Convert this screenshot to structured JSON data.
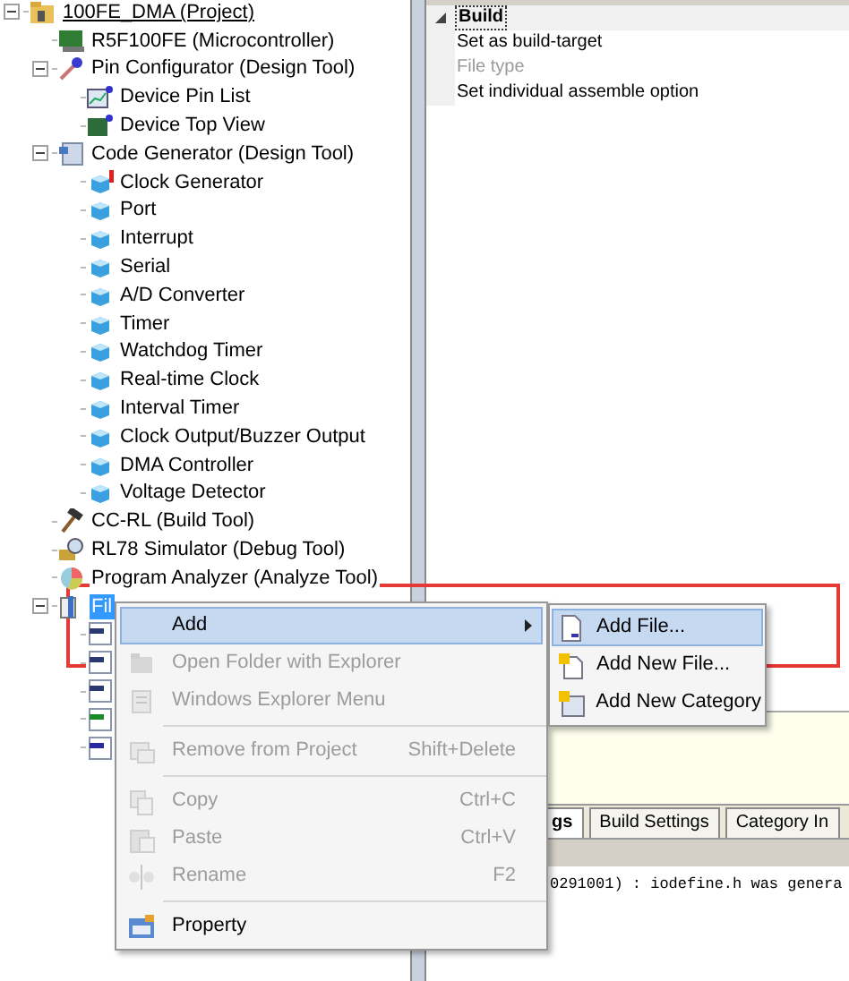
{
  "tree": [
    {
      "label": "100FE_DMA (Project)",
      "kind": "project",
      "expanded": true,
      "selected": false,
      "children": [
        {
          "label": "R5F100FE (Microcontroller)",
          "kind": "chip",
          "selected": false
        },
        {
          "label": "Pin Configurator (Design Tool)",
          "kind": "pin",
          "expanded": true,
          "selected": false,
          "children": [
            {
              "label": "Device Pin List",
              "kind": "pinlist",
              "selected": false
            },
            {
              "label": "Device Top View",
              "kind": "topview",
              "selected": false
            }
          ]
        },
        {
          "label": "Code Generator (Design Tool)",
          "kind": "codegen",
          "expanded": true,
          "selected": false,
          "children": [
            {
              "label": "Clock Generator",
              "kind": "cube-warning",
              "selected": false
            },
            {
              "label": "Port",
              "kind": "cube",
              "selected": false
            },
            {
              "label": "Interrupt",
              "kind": "cube",
              "selected": false
            },
            {
              "label": "Serial",
              "kind": "cube",
              "selected": false
            },
            {
              "label": "A/D Converter",
              "kind": "cube",
              "selected": false
            },
            {
              "label": "Timer",
              "kind": "cube",
              "selected": false
            },
            {
              "label": "Watchdog Timer",
              "kind": "cube",
              "selected": false
            },
            {
              "label": "Real-time Clock",
              "kind": "cube",
              "selected": false
            },
            {
              "label": "Interval Timer",
              "kind": "cube",
              "selected": false
            },
            {
              "label": "Clock Output/Buzzer Output",
              "kind": "cube",
              "selected": false
            },
            {
              "label": "DMA Controller",
              "kind": "cube",
              "selected": false
            },
            {
              "label": "Voltage Detector",
              "kind": "cube",
              "selected": false
            }
          ]
        },
        {
          "label": "CC-RL (Build Tool)",
          "kind": "hammer",
          "selected": false
        },
        {
          "label": "RL78 Simulator (Debug Tool)",
          "kind": "simulator",
          "selected": false
        },
        {
          "label": "Program Analyzer (Analyze Tool)",
          "kind": "analyzer",
          "selected": false
        },
        {
          "label": "Fil",
          "kind": "folder",
          "expanded": true,
          "selected": true,
          "children": [
            {
              "kind": "asm",
              "selected": false
            },
            {
              "kind": "asm",
              "selected": false
            },
            {
              "kind": "asm",
              "selected": false
            },
            {
              "kind": "c",
              "selected": false
            },
            {
              "kind": "h",
              "selected": false
            }
          ]
        }
      ]
    }
  ],
  "properties": {
    "category": "Build",
    "expanded": true,
    "rows": [
      {
        "label": "Set as build-target",
        "disabled": false
      },
      {
        "label": "File type",
        "disabled": true
      },
      {
        "label": "Set individual assemble option",
        "disabled": false
      }
    ]
  },
  "tabs": [
    {
      "label": "gs",
      "selected": true
    },
    {
      "label": "Build Settings",
      "selected": false
    },
    {
      "label": "Category In",
      "selected": false
    }
  ],
  "output": "0291001) : iodefine.h was genera",
  "context_menu": [
    {
      "kind": "submenu",
      "label": "Add",
      "disabled": false,
      "selected": true
    },
    {
      "kind": "item",
      "label": "Open Folder with Explorer",
      "disabled": true,
      "selected": false
    },
    {
      "kind": "item",
      "label": "Windows Explorer Menu",
      "disabled": true,
      "selected": false
    },
    {
      "kind": "separator"
    },
    {
      "kind": "item",
      "label": "Remove from Project",
      "shortcut": "Shift+Delete",
      "disabled": true,
      "selected": false
    },
    {
      "kind": "separator"
    },
    {
      "kind": "item",
      "label": "Copy",
      "shortcut": "Ctrl+C",
      "disabled": true,
      "selected": false
    },
    {
      "kind": "item",
      "label": "Paste",
      "shortcut": "Ctrl+V",
      "disabled": true,
      "selected": false
    },
    {
      "kind": "item",
      "label": "Rename",
      "shortcut": "F2",
      "disabled": true,
      "selected": false
    },
    {
      "kind": "separator"
    },
    {
      "kind": "item",
      "label": "Property",
      "disabled": false,
      "selected": false
    }
  ],
  "submenu": [
    {
      "label": "Add File...",
      "selected": true
    },
    {
      "label": "Add New File...",
      "selected": false
    },
    {
      "label": "Add New Category",
      "selected": false
    }
  ]
}
